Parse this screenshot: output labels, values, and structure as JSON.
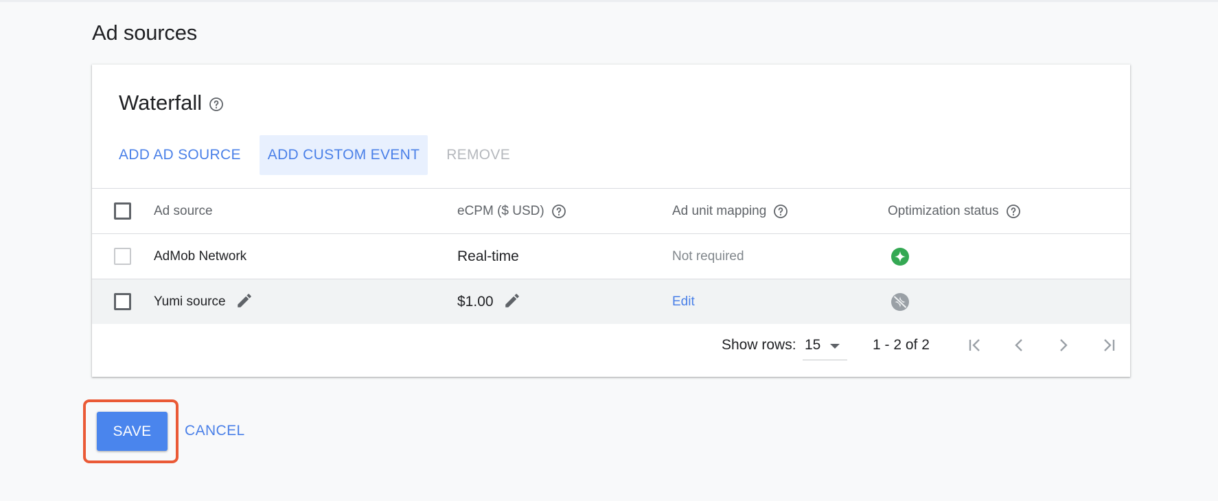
{
  "section": {
    "title": "Ad sources"
  },
  "waterfall": {
    "title": "Waterfall",
    "help_icon": "help-outline-icon",
    "toolbar": {
      "add_ad_source": "ADD AD SOURCE",
      "add_custom_event": "ADD CUSTOM EVENT",
      "remove": "REMOVE"
    },
    "table": {
      "headers": {
        "ad_source": "Ad source",
        "ecpm": "eCPM ($ USD)",
        "ad_unit_mapping": "Ad unit mapping",
        "optimization_status": "Optimization status"
      },
      "rows": [
        {
          "ad_source": "AdMob Network",
          "ecpm": "Real-time",
          "ad_unit_mapping": "Not required",
          "optimization_icon": "optimization-enabled-icon",
          "checkbox_disabled": true
        },
        {
          "ad_source": "Yumi source",
          "ecpm": "$1.00",
          "ad_unit_mapping": "Edit",
          "optimization_icon": "optimization-disabled-icon",
          "checkbox_disabled": false
        }
      ]
    },
    "pagination": {
      "show_rows_label": "Show rows:",
      "rows_per_page": "15",
      "range": "1 - 2 of 2"
    }
  },
  "actions": {
    "save": "SAVE",
    "cancel": "CANCEL"
  },
  "colors": {
    "accent": "#4a80e8",
    "save_button": "#4a85ed",
    "highlight_outline": "#ea5a36",
    "status_enabled": "#34a853",
    "status_disabled": "#9aa0a6"
  }
}
